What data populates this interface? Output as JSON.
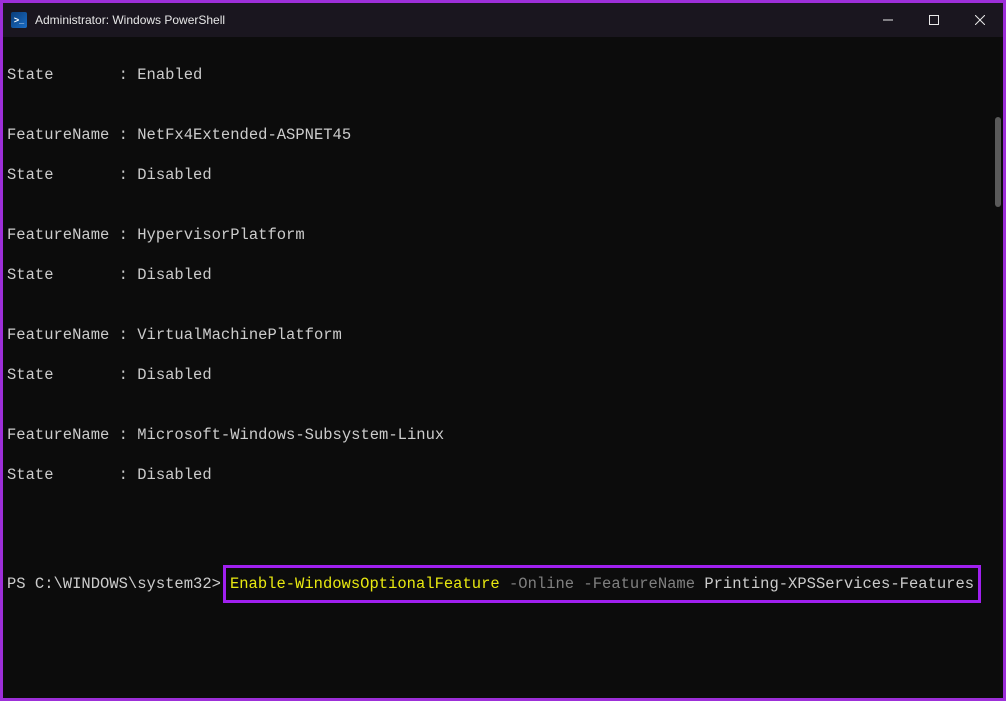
{
  "titlebar": {
    "title": "Administrator: Windows PowerShell"
  },
  "output": {
    "line01": "State       : Enabled",
    "line02": "",
    "line03": "FeatureName : NetFx4Extended-ASPNET45",
    "line04": "State       : Disabled",
    "line05": "",
    "line06": "FeatureName : HypervisorPlatform",
    "line07": "State       : Disabled",
    "line08": "",
    "line09": "FeatureName : VirtualMachinePlatform",
    "line10": "State       : Disabled",
    "line11": "",
    "line12": "FeatureName : Microsoft-Windows-Subsystem-Linux",
    "line13": "State       : Disabled"
  },
  "prompt": {
    "prefix": "PS C:\\WINDOWS\\system32>",
    "cmdlet": "Enable-WindowsOptionalFeature",
    "param1": " -Online",
    "param2": " -FeatureName",
    "arg": " Printing-XPSServices-Features"
  }
}
